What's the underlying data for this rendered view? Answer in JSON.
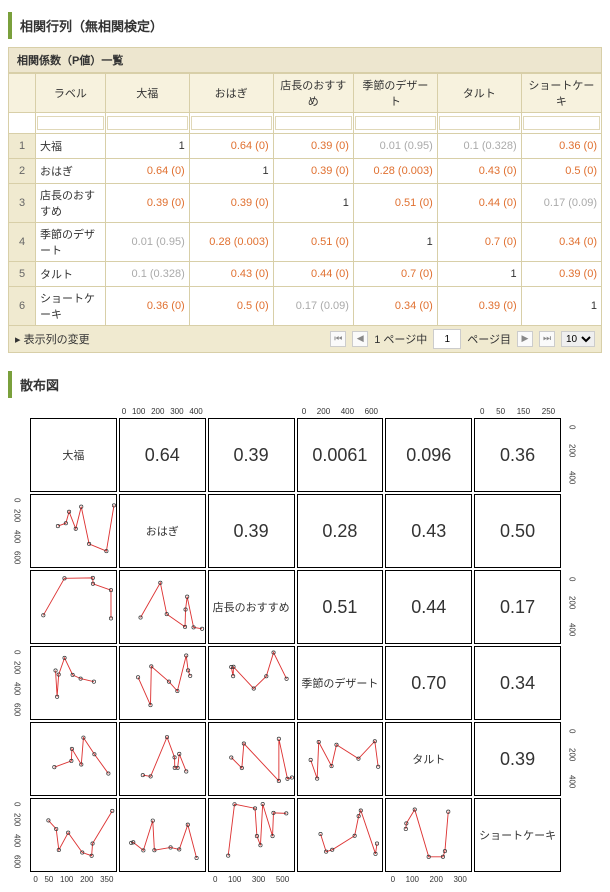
{
  "title_main": "相関行列（無相関検定）",
  "title_sub": "相関係数（P値）一覧",
  "title_scatter": "散布図",
  "headers": {
    "label": "ラベル",
    "c1": "大福",
    "c2": "おはぎ",
    "c3": "店長のおすすめ",
    "c4": "季節のデザート",
    "c5": "タルト",
    "c6": "ショートケーキ"
  },
  "rows": [
    {
      "n": "1",
      "lbl": "大福",
      "v": [
        "1",
        "0.64 (0)",
        "0.39 (0)",
        "0.01 (0.95)",
        "0.1 (0.328)",
        "0.36 (0)"
      ],
      "cls": [
        "",
        "orange",
        "orange",
        "gray",
        "gray",
        "orange"
      ]
    },
    {
      "n": "2",
      "lbl": "おはぎ",
      "v": [
        "0.64 (0)",
        "1",
        "0.39 (0)",
        "0.28 (0.003)",
        "0.43 (0)",
        "0.5 (0)"
      ],
      "cls": [
        "orange",
        "",
        "orange",
        "orange",
        "orange",
        "orange"
      ]
    },
    {
      "n": "3",
      "lbl": "店長のおすすめ",
      "v": [
        "0.39 (0)",
        "0.39 (0)",
        "1",
        "0.51 (0)",
        "0.44 (0)",
        "0.17 (0.09)"
      ],
      "cls": [
        "orange",
        "orange",
        "",
        "orange",
        "orange",
        "gray"
      ]
    },
    {
      "n": "4",
      "lbl": "季節のデザート",
      "v": [
        "0.01 (0.95)",
        "0.28 (0.003)",
        "0.51 (0)",
        "1",
        "0.7 (0)",
        "0.34 (0)"
      ],
      "cls": [
        "gray",
        "orange",
        "orange",
        "",
        "orange",
        "orange"
      ]
    },
    {
      "n": "5",
      "lbl": "タルト",
      "v": [
        "0.1 (0.328)",
        "0.43 (0)",
        "0.44 (0)",
        "0.7 (0)",
        "1",
        "0.39 (0)"
      ],
      "cls": [
        "gray",
        "orange",
        "orange",
        "orange",
        "",
        "orange"
      ]
    },
    {
      "n": "6",
      "lbl": "ショートケーキ",
      "v": [
        "0.36 (0)",
        "0.5 (0)",
        "0.17 (0.09)",
        "0.34 (0)",
        "0.39 (0)",
        "1"
      ],
      "cls": [
        "orange",
        "orange",
        "gray",
        "orange",
        "orange",
        ""
      ]
    }
  ],
  "pager": {
    "cols_label": "表示列の変更",
    "pages_fmt_pre": "1 ページ中",
    "page_input": "1",
    "pages_fmt_post": "ページ目",
    "rows_select": "10",
    "nav": {
      "first": "⏮",
      "prev": "◀",
      "next": "▶",
      "last": "⏭"
    }
  },
  "splom_labels": [
    "大福",
    "おはぎ",
    "店長のおすすめ",
    "季節のデザート",
    "タルト",
    "ショートケーキ"
  ],
  "splom_upper": {
    "r0": [
      "0.64",
      "0.39",
      "0.0061",
      "0.096",
      "0.36"
    ],
    "r1": [
      "0.39",
      "0.28",
      "0.43",
      "0.50"
    ],
    "r2": [
      "0.51",
      "0.44",
      "0.17"
    ],
    "r3": [
      "0.70",
      "0.34"
    ],
    "r4": [
      "0.39"
    ]
  },
  "axis_top": {
    "c1": "0 100 200 300 400",
    "c3": "0 200 400 600",
    "c5": "0 50 150 250"
  },
  "axis_bottom": {
    "c0": "0 50 100 200 350",
    "c2": "0 100 300 500",
    "c4": "0 100 200 300"
  },
  "axis_side_l": "0 200 400 600",
  "axis_side_r": "0 200 400",
  "chart_data": {
    "type": "table",
    "title": "相関行列（無相関検定）",
    "variables": [
      "大福",
      "おはぎ",
      "店長のおすすめ",
      "季節のデザート",
      "タルト",
      "ショートケーキ"
    ],
    "correlation": [
      [
        1.0,
        0.64,
        0.39,
        0.01,
        0.1,
        0.36
      ],
      [
        0.64,
        1.0,
        0.39,
        0.28,
        0.43,
        0.5
      ],
      [
        0.39,
        0.39,
        1.0,
        0.51,
        0.44,
        0.17
      ],
      [
        0.01,
        0.28,
        0.51,
        1.0,
        0.7,
        0.34
      ],
      [
        0.1,
        0.43,
        0.44,
        0.7,
        1.0,
        0.39
      ],
      [
        0.36,
        0.5,
        0.17,
        0.34,
        0.39,
        1.0
      ]
    ],
    "p_values": [
      [
        null,
        0,
        0,
        0.95,
        0.328,
        0
      ],
      [
        0,
        null,
        0,
        0.003,
        0,
        0
      ],
      [
        0,
        0,
        null,
        0,
        0,
        0.09
      ],
      [
        0.95,
        0.003,
        0,
        null,
        0,
        0
      ],
      [
        0.328,
        0,
        0,
        0,
        null,
        0
      ],
      [
        0,
        0,
        0.09,
        0,
        0,
        null
      ]
    ],
    "splom_display_upper": [
      [
        null,
        0.64,
        0.39,
        0.0061,
        0.096,
        0.36
      ],
      [
        null,
        null,
        0.39,
        0.28,
        0.43,
        0.5
      ],
      [
        null,
        null,
        null,
        0.51,
        0.44,
        0.17
      ],
      [
        null,
        null,
        null,
        null,
        0.7,
        0.34
      ],
      [
        null,
        null,
        null,
        null,
        null,
        0.39
      ]
    ]
  }
}
